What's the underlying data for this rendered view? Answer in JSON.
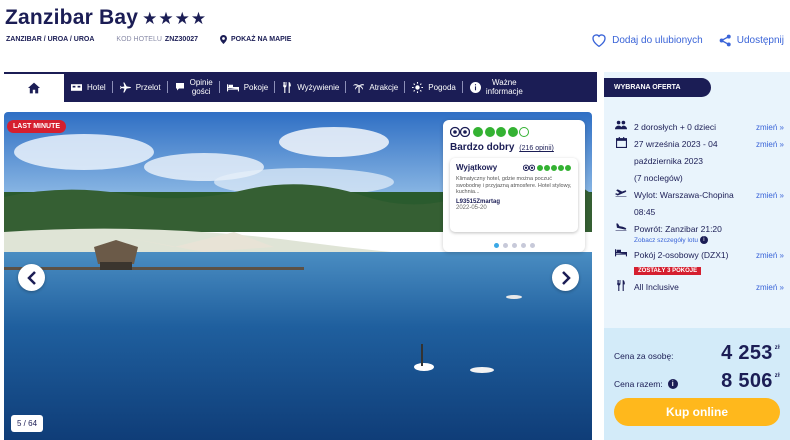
{
  "hotel": {
    "name": "Zanzibar Bay",
    "stars": "★★★★",
    "location": "ZANZIBAR / UROA / UROA",
    "code_label": "KOD HOTELU",
    "code_value": "ZNZ30027",
    "map_link": "POKAŻ NA MAPIE"
  },
  "top_actions": {
    "favorite": "Dodaj do ulubionych",
    "share": "Udostępnij"
  },
  "nav": {
    "items": [
      {
        "label": "Hotel",
        "icon": "hotel-icon"
      },
      {
        "label": "Przelot",
        "icon": "plane-icon"
      },
      {
        "label": "Opinie gości",
        "line1": "Opinie",
        "line2": "gości",
        "icon": "comment-icon"
      },
      {
        "label": "Pokoje",
        "icon": "bed-icon"
      },
      {
        "label": "Wyżywienie",
        "icon": "fork-knife-icon"
      },
      {
        "label": "Atrakcje",
        "icon": "palm-icon"
      },
      {
        "label": "Pogoda",
        "icon": "sun-icon"
      },
      {
        "label": "Ważne informacje",
        "line1": "Ważne",
        "line2": "informacje",
        "icon": "info-icon"
      }
    ]
  },
  "gallery": {
    "badge": "LAST MINUTE",
    "counter": "5 / 64"
  },
  "tripadvisor": {
    "bubbles": 4,
    "bubbles_max": 5,
    "rating_text": "Bardzo dobry",
    "review_count": "(216 opinii)",
    "review": {
      "title": "Wyjątkowy",
      "bubbles": 5,
      "text": "Klimatyczny hotel, gdzie można poczuć swobodnę i przyjazną atmosfere. Hotel stylowy, kuchnia...",
      "author": "L93515Zmartag",
      "date": "2022-05-20"
    }
  },
  "offer": {
    "tag": "WYBRANA OFERTA",
    "change_label": "zmień »",
    "guests": "2 dorosłych + 0 dzieci",
    "dates_line1": "27 września 2023 - 04",
    "dates_line2": "października 2023",
    "dates_line3": "(7 noclegów)",
    "departure_line1": "Wylot: Warszawa-Chopina",
    "departure_line2": "08:45",
    "return": "Powrót: Zanzibar 21:20",
    "flight_details": "Zobacz szczegóły lotu",
    "room": "Pokój 2-osobowy (DZX1)",
    "rooms_left": "ZOSTAŁY 3 POKOJE",
    "board": "All Inclusive",
    "price_per_person_label": "Cena za osobę:",
    "price_per_person": "4 253",
    "price_total_label": "Cena razem:",
    "price_total": "8 506",
    "currency": "zł",
    "buy_button": "Kup online"
  },
  "colors": {
    "navy": "#1b1d55",
    "link": "#3a64d8",
    "red": "#d51f2f",
    "cta": "#ffb81c",
    "tripadvisor_green": "#34b233"
  }
}
